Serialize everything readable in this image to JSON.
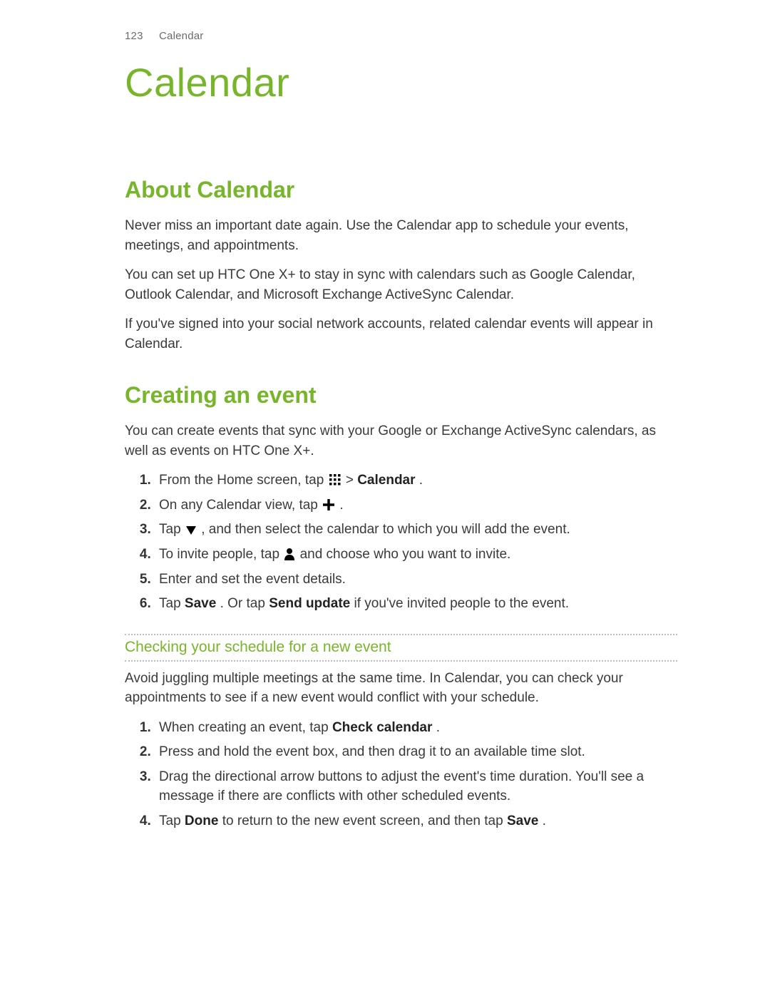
{
  "header": {
    "page_number": "123",
    "section_name": "Calendar"
  },
  "chapter_title": "Calendar",
  "about": {
    "heading": "About Calendar",
    "p1": "Never miss an important date again. Use the Calendar app to schedule your events, meetings, and appointments.",
    "p2": "You can set up HTC One X+ to stay in sync with calendars such as Google Calendar, Outlook Calendar, and Microsoft Exchange ActiveSync Calendar.",
    "p3": "If you've signed into your social network accounts, related calendar events will appear in Calendar."
  },
  "creating": {
    "heading": "Creating an event",
    "intro": "You can create events that sync with your Google or Exchange ActiveSync calendars, as well as events on HTC One X+.",
    "steps": {
      "s1_a": "From the Home screen, tap ",
      "s1_b": " > ",
      "s1_c": "Calendar",
      "s1_d": ".",
      "s2_a": "On any Calendar view, tap ",
      "s2_b": ".",
      "s3_a": "Tap ",
      "s3_b": ", and then select the calendar to which you will add the event.",
      "s4_a": "To invite people, tap ",
      "s4_b": " and choose who you want to invite.",
      "s5": "Enter and set the event details.",
      "s6_a": "Tap ",
      "s6_b": "Save",
      "s6_c": ". Or tap ",
      "s6_d": "Send update",
      "s6_e": " if you've invited people to the event."
    }
  },
  "checking": {
    "heading": "Checking your schedule for a new event",
    "intro": "Avoid juggling multiple meetings at the same time. In Calendar, you can check your appointments to see if a new event would conflict with your schedule.",
    "steps": {
      "s1_a": "When creating an event, tap ",
      "s1_b": "Check calendar",
      "s1_c": ".",
      "s2": "Press and hold the event box, and then drag it to an available time slot.",
      "s3": "Drag the directional arrow buttons to adjust the event's time duration. You'll see a message if there are conflicts with other scheduled events.",
      "s4_a": "Tap ",
      "s4_b": "Done",
      "s4_c": " to return to the new event screen, and then tap ",
      "s4_d": "Save",
      "s4_e": "."
    }
  },
  "icons": {
    "apps_grid": "apps-grid-icon",
    "plus": "plus-icon",
    "triangle_down": "triangle-down-icon",
    "person": "person-icon"
  }
}
